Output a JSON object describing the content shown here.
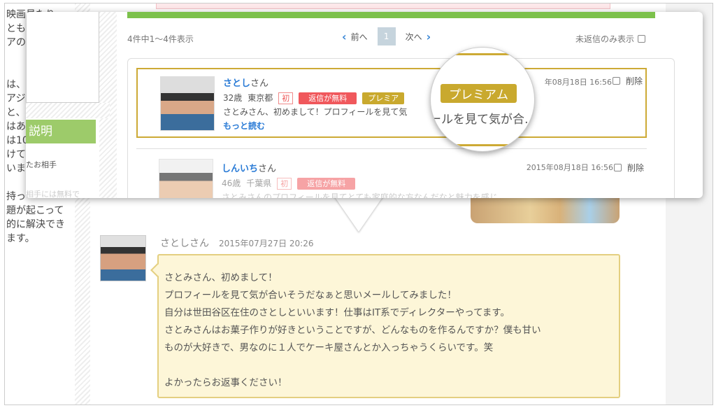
{
  "background": {
    "left_text_lines": [
      "映画見たり",
      "とも",
      "アの",
      "",
      "",
      "は、",
      "アジ",
      "と、",
      "はあ",
      "は10",
      "けて",
      "いま",
      "",
      "持っ",
      "題が起こって",
      "的に解決でき",
      "ます。"
    ]
  },
  "popup_left": {
    "heading": "説明",
    "line1": "たお相手",
    "line2": "相手には無料で"
  },
  "list": {
    "count_text": "4件中1〜4件表示",
    "pager": {
      "prev": "前へ",
      "current": "1",
      "next": "次へ"
    },
    "unreplied_only": "未返信のみ表示",
    "items": [
      {
        "name": "さとし",
        "suffix": "さん",
        "age": "32歳",
        "pref": "東京都",
        "badge_first": "初",
        "badge_free": "返信が無料",
        "badge_premium": "プレミア",
        "preview": "さとみさん、初めまして！プロフィールを見て気",
        "more": "もっと読む",
        "date": "年08月18日 16:56",
        "delete": "削除"
      },
      {
        "name": "しんいち",
        "suffix": "さん",
        "age": "46歳",
        "pref": "千葉県",
        "badge_first": "初",
        "badge_free": "返信が無料",
        "preview": "さとみさんのプロフィールを見てとても家庭的な方なんだなと魅力を感じ",
        "date": "2015年08月18日 16:56",
        "delete": "削除"
      }
    ],
    "magnifier": {
      "badge": "プレミアム",
      "text": "ールを見て気が合…"
    }
  },
  "message": {
    "sender": "さとしさん",
    "date": "2015年07月27日 20:26",
    "body": "さとみさん、初めまして！\nプロフィールを見て気が合いそうだなぁと思いメールしてみました！\n自分は世田谷区在住のさとしといいます！仕事はIT系でディレクターやってます。\nさとみさんはお菓子作りが好きということですが、どんなものを作るんですか？僕も甘い\nものが大好きで、男なのに１人でケーキ屋さんとか入っちゃうくらいです。笑\n\nよかったらお返事ください！"
  },
  "colors": {
    "accent_blue": "#2a7bd6",
    "premium_gold": "#c9a92e",
    "free_red": "#f0585c",
    "green": "#7cc14b",
    "bubble": "#fdf6d8"
  }
}
